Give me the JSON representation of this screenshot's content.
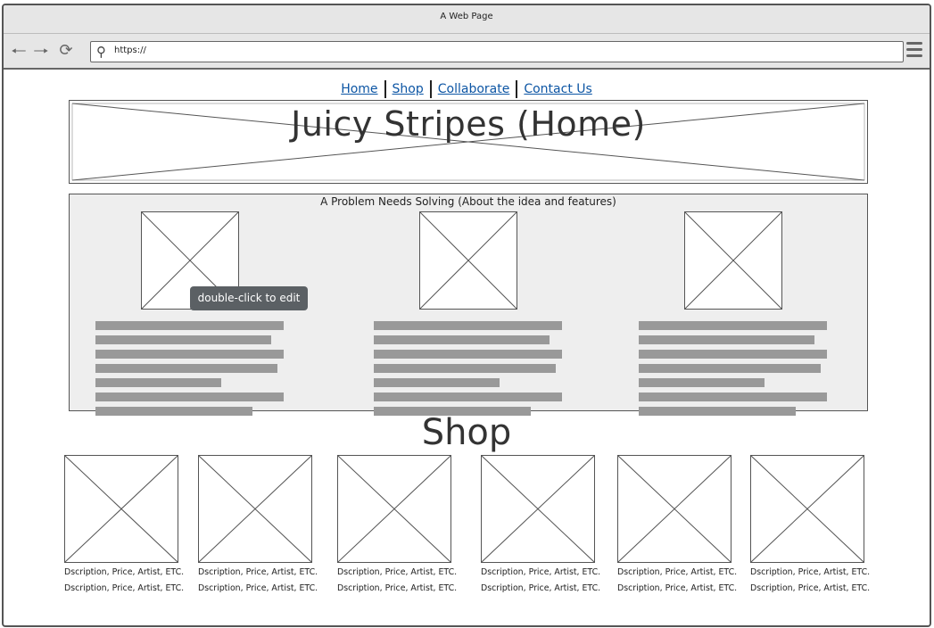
{
  "window": {
    "title": "A Web Page"
  },
  "browser": {
    "url": "https://",
    "back_icon": "arrow-left-icon",
    "forward_icon": "arrow-right-icon",
    "reload_icon": "reload-icon",
    "search_icon": "search-icon",
    "menu_icon": "hamburger-menu-icon"
  },
  "nav": {
    "links": [
      {
        "label": "Home"
      },
      {
        "label": "Shop"
      },
      {
        "label": "Collaborate"
      },
      {
        "label": "Contact Us"
      }
    ]
  },
  "hero": {
    "title": "Juicy Stripes (Home)"
  },
  "features": {
    "title": "A Problem Needs Solving (About the idea and features)"
  },
  "tooltip": {
    "text": "double-click to edit"
  },
  "shop": {
    "title": "Shop",
    "products": [
      {
        "line1": "Dscription, Price, Artist, ETC.",
        "line2": "Dscription, Price, Artist, ETC."
      },
      {
        "line1": "Dscription, Price, Artist, ETC.",
        "line2": "Dscription, Price, Artist, ETC."
      },
      {
        "line1": "Dscription, Price, Artist, ETC.",
        "line2": "Dscription, Price, Artist, ETC."
      },
      {
        "line1": "Dscription, Price, Artist, ETC.",
        "line2": "Dscription, Price, Artist, ETC."
      },
      {
        "line1": "Dscription, Price, Artist, ETC.",
        "line2": "Dscription, Price, Artist, ETC."
      },
      {
        "line1": "Dscription, Price, Artist, ETC.",
        "line2": "Dscription, Price, Artist, ETC."
      }
    ]
  },
  "colors": {
    "link": "#0c55a4",
    "chrome": "#e6e6e6",
    "placeholder_text": "#999999",
    "panel": "#eeeeee",
    "tooltip": "#5b6064"
  }
}
